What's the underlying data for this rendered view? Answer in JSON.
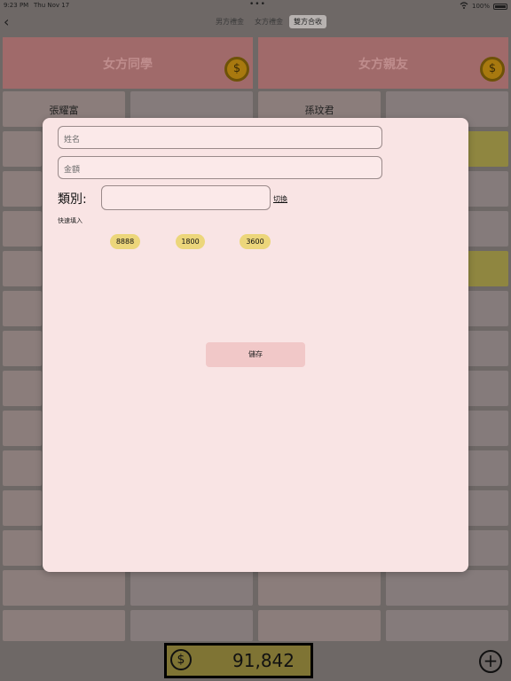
{
  "status_bar": {
    "time": "9:23 PM",
    "date": "Thu Nov 17",
    "battery": "100%"
  },
  "nav": {
    "back_icon": "chevron-left-icon",
    "segments": [
      {
        "label": "男方禮金"
      },
      {
        "label": "女方禮金"
      },
      {
        "label": "雙方合收",
        "active": true
      }
    ]
  },
  "cards": [
    {
      "title": "女方同學",
      "coin_icon": "$"
    },
    {
      "title": "女方親友",
      "coin_icon": "$"
    }
  ],
  "grid_names": [
    "張耀富",
    "孫玟君"
  ],
  "total": {
    "currency_icon": "$",
    "amount": "91,842"
  },
  "add_icon": "+",
  "modal": {
    "name_placeholder": "姓名",
    "amount_placeholder": "金額",
    "category_label": "類別:",
    "category_value": "",
    "switch_label": "切換",
    "quick_fill_label": "快速填入",
    "chips": [
      "8888",
      "1800",
      "3600"
    ],
    "save_label": "儲存"
  },
  "colors": {
    "accent_gold": "#ecd67b",
    "modal_bg": "#f9e4e4",
    "card_head": "#a06a6a"
  }
}
